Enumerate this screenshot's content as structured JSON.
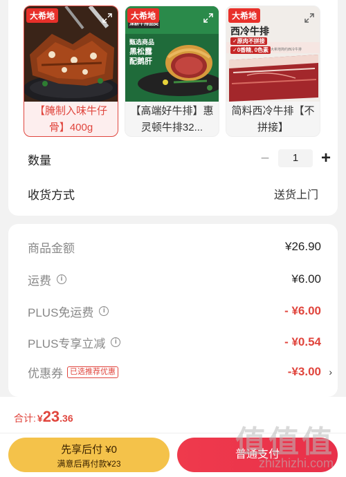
{
  "products": [
    {
      "brand": "大希地",
      "title": "【腌制入味牛仔骨】400g",
      "selected": true
    },
    {
      "brand": "大希地",
      "brand_sub": "深耕牛排品类",
      "title": "【高端好牛排】惠灵顿牛排32...",
      "overlay_lines": [
        "甄选商品",
        "黑松露",
        "配鹅肝"
      ],
      "selected": false
    },
    {
      "brand": "大希地",
      "title": "简料西冷牛排【不拼接】",
      "overlay_title": "西冷牛排",
      "overlay_tags": [
        "✓原肉不拼接",
        "✓0香精, 0色素"
      ],
      "overlay_small": "大希地简约西冷牛排",
      "selected": false
    }
  ],
  "quantity": {
    "label": "数量",
    "value": "1",
    "minus": "−",
    "plus": "+"
  },
  "delivery": {
    "label": "收货方式",
    "value": "送货上门"
  },
  "fees": {
    "goods_amount": {
      "label": "商品金额",
      "value": "¥26.90"
    },
    "shipping": {
      "label": "运费",
      "value": "¥6.00",
      "info_icon": "ⓘ"
    },
    "plus_free_shipping": {
      "label": "PLUS免运费",
      "value": "- ¥6.00"
    },
    "plus_discount": {
      "label": "PLUS专享立减",
      "value": "- ¥0.54"
    },
    "coupon": {
      "label": "优惠券",
      "tag": "已选推荐优惠",
      "value": "-¥3.00",
      "chevron": "›"
    }
  },
  "total": {
    "label": "合计:",
    "currency": "¥",
    "integer": "23",
    "decimal": ".36"
  },
  "buttons": {
    "pay_later": {
      "line1": "先享后付 ¥0",
      "line2": "满意后再付款¥23"
    },
    "pay": {
      "label": "普通支付"
    }
  },
  "watermark": {
    "brand_chars": "值",
    "site": "zhizhizhi.com"
  },
  "colors": {
    "accent": "#e0453d",
    "pay_button": "#ec3549",
    "pay_later_button": "#f4c24a"
  }
}
